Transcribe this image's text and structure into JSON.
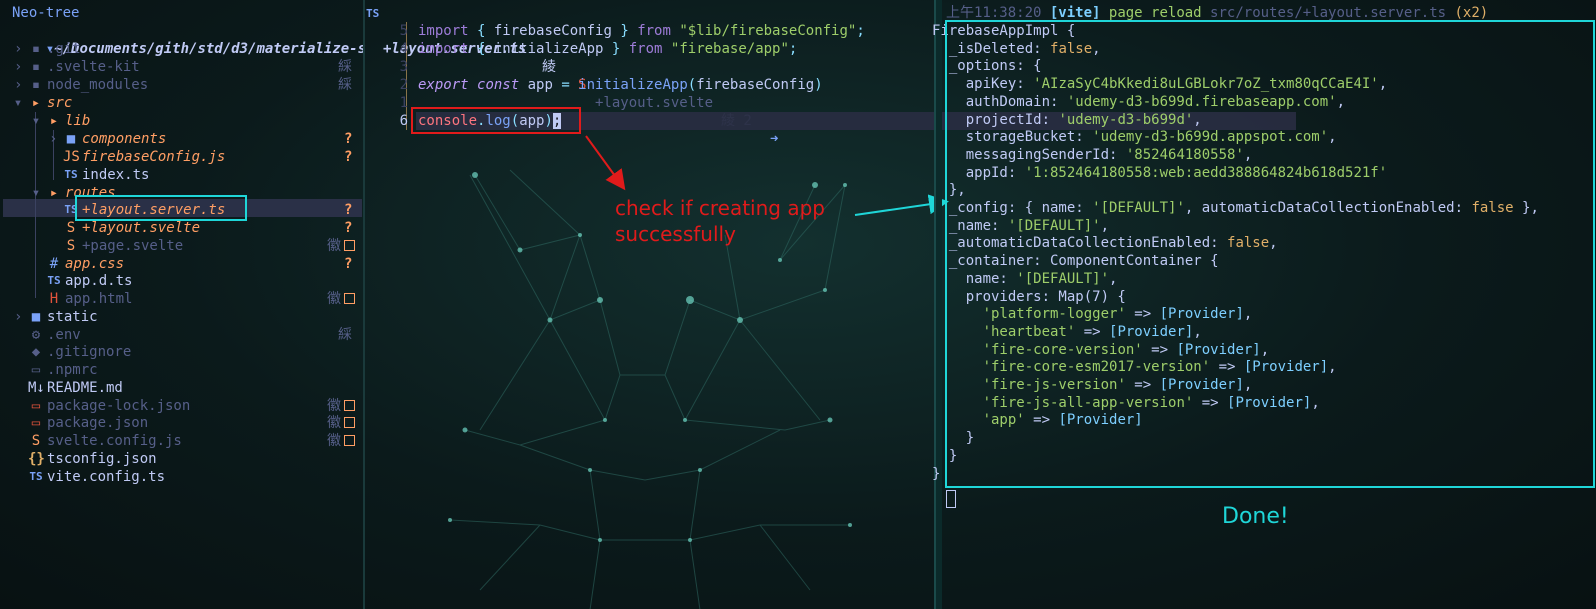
{
  "neotree": {
    "title": "Neo-tree",
    "path": "~/Documents/gith/std/d3/materialize-s",
    "items": [
      {
        "name": ".git",
        "status": ""
      },
      {
        "name": ".svelte-kit",
        "status": "綵"
      },
      {
        "name": "node_modules",
        "status": "綵"
      },
      {
        "name": "src",
        "status": ""
      },
      {
        "name": "lib",
        "status": ""
      },
      {
        "name": "components",
        "status": "?"
      },
      {
        "name": "firebaseConfig.js",
        "status": "?"
      },
      {
        "name": "index.ts",
        "status": ""
      },
      {
        "name": "routes",
        "status": ""
      },
      {
        "name": "+layout.server.ts",
        "status": "?"
      },
      {
        "name": "+layout.svelte",
        "status": "?"
      },
      {
        "name": "+page.svelte",
        "status": "徽"
      },
      {
        "name": "app.css",
        "status": "?"
      },
      {
        "name": "app.d.ts",
        "status": ""
      },
      {
        "name": "app.html",
        "status": "徽"
      },
      {
        "name": "static",
        "status": ""
      },
      {
        "name": ".env",
        "status": "綵"
      },
      {
        "name": ".gitignore",
        "status": ""
      },
      {
        "name": ".npmrc",
        "status": ""
      },
      {
        "name": "README.md",
        "status": ""
      },
      {
        "name": "package-lock.json",
        "status": "徽"
      },
      {
        "name": "package.json",
        "status": "徽"
      },
      {
        "name": "svelte.config.js",
        "status": "徽"
      },
      {
        "name": "tsconfig.json",
        "status": ""
      },
      {
        "name": "vite.config.ts",
        "status": ""
      }
    ]
  },
  "editor": {
    "tab_active": "+layout.server.ts",
    "tab_active_mark": "綾",
    "tab_other": "+layout.svelte",
    "tab_other_mark": "綾 2",
    "lines": [
      {
        "num": "5",
        "parts": [
          [
            "kw",
            "import"
          ],
          [
            "pun",
            " { "
          ],
          [
            "var",
            "firebaseConfig"
          ],
          [
            "pun",
            " } "
          ],
          [
            "kw",
            "from "
          ],
          [
            "str",
            "\"$lib/firebaseConfig\""
          ],
          [
            "pun",
            ";"
          ]
        ]
      },
      {
        "num": "4",
        "parts": [
          [
            "kw",
            "import"
          ],
          [
            "pun",
            " { "
          ],
          [
            "var",
            "initializeApp"
          ],
          [
            "pun",
            " } "
          ],
          [
            "kw",
            "from "
          ],
          [
            "str",
            "\"firebase/app\""
          ],
          [
            "pun",
            ";"
          ]
        ]
      },
      {
        "num": "3",
        "parts": []
      },
      {
        "num": "2",
        "parts": [
          [
            "kw-it",
            "export "
          ],
          [
            "kw-it",
            "const "
          ],
          [
            "var",
            "app "
          ],
          [
            "pun",
            "= "
          ],
          [
            "fn",
            "initializeApp"
          ],
          [
            "pun",
            "("
          ],
          [
            "var",
            "firebaseConfig"
          ],
          [
            "pun",
            ")"
          ]
        ]
      },
      {
        "num": "1",
        "parts": []
      },
      {
        "num": "6",
        "parts": [
          [
            "obj",
            "console"
          ],
          [
            "pun",
            "."
          ],
          [
            "fn",
            "log"
          ],
          [
            "pun",
            "("
          ],
          [
            "var",
            "app"
          ],
          [
            "pun",
            ")"
          ],
          [
            "var",
            ";"
          ]
        ]
      }
    ],
    "annotation_line1": "check if creating app",
    "annotation_line2": "successfully"
  },
  "terminal": {
    "header_time": "上午11:38:20",
    "header_vite": "[vite]",
    "header_msg": "page reload",
    "header_path": "src/routes/+layout.server.ts",
    "header_count": "(x2)",
    "lines": [
      [
        [
          "tkey",
          "FirebaseAppImpl {"
        ]
      ],
      [
        [
          "tkey",
          "  _isDeleted: "
        ],
        [
          "tboo",
          "false"
        ],
        [
          "tkey",
          ","
        ]
      ],
      [
        [
          "tkey",
          "  _options: {"
        ]
      ],
      [
        [
          "tkey",
          "    apiKey: "
        ],
        [
          "tstr",
          "'AIzaSyC4bKkedi8uLGBLokr7oZ_txm80qCCaE4I'"
        ],
        [
          "tkey",
          ","
        ]
      ],
      [
        [
          "tkey",
          "    authDomain: "
        ],
        [
          "tstr",
          "'udemy-d3-b699d.firebaseapp.com'"
        ],
        [
          "tkey",
          ","
        ]
      ],
      [
        [
          "tkey",
          "    projectId: "
        ],
        [
          "tstr",
          "'udemy-d3-b699d'"
        ],
        [
          "tkey",
          ","
        ]
      ],
      [
        [
          "tkey",
          "    storageBucket: "
        ],
        [
          "tstr",
          "'udemy-d3-b699d.appspot.com'"
        ],
        [
          "tkey",
          ","
        ]
      ],
      [
        [
          "tkey",
          "    messagingSenderId: "
        ],
        [
          "tstr",
          "'852464180558'"
        ],
        [
          "tkey",
          ","
        ]
      ],
      [
        [
          "tkey",
          "    appId: "
        ],
        [
          "tstr",
          "'1:852464180558:web:aedd388864824b618d521f'"
        ]
      ],
      [
        [
          "tkey",
          "  },"
        ]
      ],
      [
        [
          "tkey",
          "  _config: { name: "
        ],
        [
          "tstr",
          "'[DEFAULT]'"
        ],
        [
          "tkey",
          ", automaticDataCollectionEnabled: "
        ],
        [
          "tboo",
          "false"
        ],
        [
          "tkey",
          " },"
        ]
      ],
      [
        [
          "tkey",
          "  _name: "
        ],
        [
          "tstr",
          "'[DEFAULT]'"
        ],
        [
          "tkey",
          ","
        ]
      ],
      [
        [
          "tkey",
          "  _automaticDataCollectionEnabled: "
        ],
        [
          "tboo",
          "false"
        ],
        [
          "tkey",
          ","
        ]
      ],
      [
        [
          "tkey",
          "  _container: ComponentContainer {"
        ]
      ],
      [
        [
          "tkey",
          "    name: "
        ],
        [
          "tstr",
          "'[DEFAULT]'"
        ],
        [
          "tkey",
          ","
        ]
      ],
      [
        [
          "tkey",
          "    providers: Map(7) {"
        ]
      ],
      [
        [
          "tkey",
          "      "
        ],
        [
          "tstr",
          "'platform-logger'"
        ],
        [
          "tkey",
          " => "
        ],
        [
          "tprov",
          "[Provider]"
        ],
        [
          "tkey",
          ","
        ]
      ],
      [
        [
          "tkey",
          "      "
        ],
        [
          "tstr",
          "'heartbeat'"
        ],
        [
          "tkey",
          " => "
        ],
        [
          "tprov",
          "[Provider]"
        ],
        [
          "tkey",
          ","
        ]
      ],
      [
        [
          "tkey",
          "      "
        ],
        [
          "tstr",
          "'fire-core-version'"
        ],
        [
          "tkey",
          " => "
        ],
        [
          "tprov",
          "[Provider]"
        ],
        [
          "tkey",
          ","
        ]
      ],
      [
        [
          "tkey",
          "      "
        ],
        [
          "tstr",
          "'fire-core-esm2017-version'"
        ],
        [
          "tkey",
          " => "
        ],
        [
          "tprov",
          "[Provider]"
        ],
        [
          "tkey",
          ","
        ]
      ],
      [
        [
          "tkey",
          "      "
        ],
        [
          "tstr",
          "'fire-js-version'"
        ],
        [
          "tkey",
          " => "
        ],
        [
          "tprov",
          "[Provider]"
        ],
        [
          "tkey",
          ","
        ]
      ],
      [
        [
          "tkey",
          "      "
        ],
        [
          "tstr",
          "'fire-js-all-app-version'"
        ],
        [
          "tkey",
          " => "
        ],
        [
          "tprov",
          "[Provider]"
        ],
        [
          "tkey",
          ","
        ]
      ],
      [
        [
          "tkey",
          "      "
        ],
        [
          "tstr",
          "'app'"
        ],
        [
          "tkey",
          " => "
        ],
        [
          "tprov",
          "[Provider]"
        ]
      ],
      [
        [
          "tkey",
          "    }"
        ]
      ],
      [
        [
          "tkey",
          "  }"
        ]
      ],
      [
        [
          "tkey",
          "}"
        ]
      ]
    ],
    "done_label": "Done!"
  },
  "colors": {
    "accent_cyan": "#1fd6d8",
    "annotation_red": "#e01b1b"
  }
}
